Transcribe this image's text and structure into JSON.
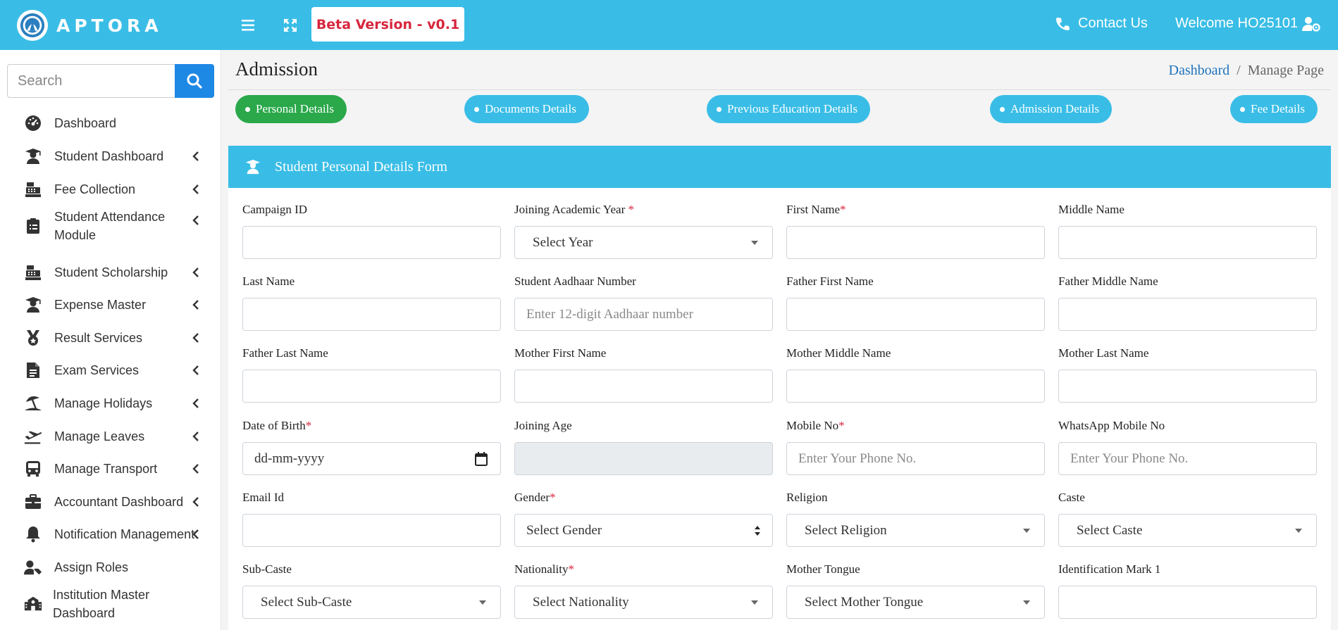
{
  "app": {
    "brand": "APTORA",
    "beta_label": "Beta Version - v0.1",
    "contact_label": "Contact Us",
    "welcome_label": "Welcome HO25101"
  },
  "sidebar": {
    "search_placeholder": "Search",
    "items": [
      {
        "label": "Dashboard",
        "icon": "dashboard-icon",
        "has_children": false
      },
      {
        "label": "Student Dashboard",
        "icon": "graduate-icon",
        "has_children": true
      },
      {
        "label": "Fee Collection",
        "icon": "cash-register-icon",
        "has_children": true
      },
      {
        "label": "Student Attendance Module",
        "icon": "clipboard-icon",
        "has_children": true
      },
      {
        "label": "Student Scholarship",
        "icon": "cash-register-icon",
        "has_children": true
      },
      {
        "label": "Expense Master",
        "icon": "graduate-icon",
        "has_children": true
      },
      {
        "label": "Result Services",
        "icon": "medal-icon",
        "has_children": true
      },
      {
        "label": "Exam Services",
        "icon": "file-icon",
        "has_children": true
      },
      {
        "label": "Manage Holidays",
        "icon": "umbrella-beach-icon",
        "has_children": true
      },
      {
        "label": "Manage Leaves",
        "icon": "plane-icon",
        "has_children": true
      },
      {
        "label": "Manage Transport",
        "icon": "bus-icon",
        "has_children": true
      },
      {
        "label": "Accountant Dashboard",
        "icon": "briefcase-icon",
        "has_children": true
      },
      {
        "label": "Notification Management",
        "icon": "bell-icon",
        "has_children": true
      },
      {
        "label": "Assign Roles",
        "icon": "user-tag-icon",
        "has_children": false
      },
      {
        "label": "Institution Master Dashboard",
        "icon": "school-icon",
        "has_children": false
      }
    ]
  },
  "page": {
    "title": "Admission",
    "breadcrumb": {
      "home": "Dashboard",
      "separator": "/",
      "current": "Manage Page"
    }
  },
  "steps": [
    {
      "label": "Personal Details",
      "active": true
    },
    {
      "label": "Documents Details",
      "active": false
    },
    {
      "label": "Previous Education Details",
      "active": false
    },
    {
      "label": "Admission Details",
      "active": false
    },
    {
      "label": "Fee Details",
      "active": false
    }
  ],
  "form": {
    "title": "Student Personal Details Form",
    "fields": [
      {
        "label": "Campaign ID",
        "required": false,
        "type": "text",
        "value": ""
      },
      {
        "label": "Joining Academic Year",
        "required": true,
        "type": "select",
        "value": "Select Year"
      },
      {
        "label": "First Name",
        "required": true,
        "type": "text",
        "value": ""
      },
      {
        "label": "Middle Name",
        "required": false,
        "type": "text",
        "value": ""
      },
      {
        "label": "Last Name",
        "required": false,
        "type": "text",
        "value": ""
      },
      {
        "label": "Student Aadhaar Number",
        "required": false,
        "type": "text",
        "placeholder": "Enter 12-digit Aadhaar number"
      },
      {
        "label": "Father First Name",
        "required": false,
        "type": "text",
        "value": ""
      },
      {
        "label": "Father Middle Name",
        "required": false,
        "type": "text",
        "value": ""
      },
      {
        "label": "Father Last Name",
        "required": false,
        "type": "text",
        "value": ""
      },
      {
        "label": "Mother First Name",
        "required": false,
        "type": "text",
        "value": ""
      },
      {
        "label": "Mother Middle Name",
        "required": false,
        "type": "text",
        "value": ""
      },
      {
        "label": "Mother Last Name",
        "required": false,
        "type": "text",
        "value": ""
      },
      {
        "label": "Date of Birth",
        "required": true,
        "type": "date",
        "value": "dd-mm-yyyy"
      },
      {
        "label": "Joining Age",
        "required": false,
        "type": "disabled",
        "value": ""
      },
      {
        "label": "Mobile No",
        "required": true,
        "type": "text",
        "placeholder": "Enter Your Phone No."
      },
      {
        "label": "WhatsApp Mobile No",
        "required": false,
        "type": "text",
        "placeholder": "Enter Your Phone No."
      },
      {
        "label": "Email Id",
        "required": false,
        "type": "text",
        "value": ""
      },
      {
        "label": "Gender",
        "required": true,
        "type": "native-select",
        "value": "Select Gender"
      },
      {
        "label": "Religion",
        "required": false,
        "type": "select",
        "value": "Select Religion"
      },
      {
        "label": "Caste",
        "required": false,
        "type": "select",
        "value": "Select Caste"
      },
      {
        "label": "Sub-Caste",
        "required": false,
        "type": "select",
        "value": "Select Sub-Caste"
      },
      {
        "label": "Nationality",
        "required": true,
        "type": "select",
        "value": "Select Nationality"
      },
      {
        "label": "Mother Tongue",
        "required": false,
        "type": "select",
        "value": "Select Mother Tongue"
      },
      {
        "label": "Identification Mark 1",
        "required": false,
        "type": "text",
        "value": ""
      }
    ]
  },
  "colors": {
    "topbar": "#39bde6",
    "active_step": "#2aa84a",
    "search_button": "#1e88e5",
    "beta_text": "#d7263d",
    "required_mark": "#d7263d",
    "link": "#1e73be"
  }
}
